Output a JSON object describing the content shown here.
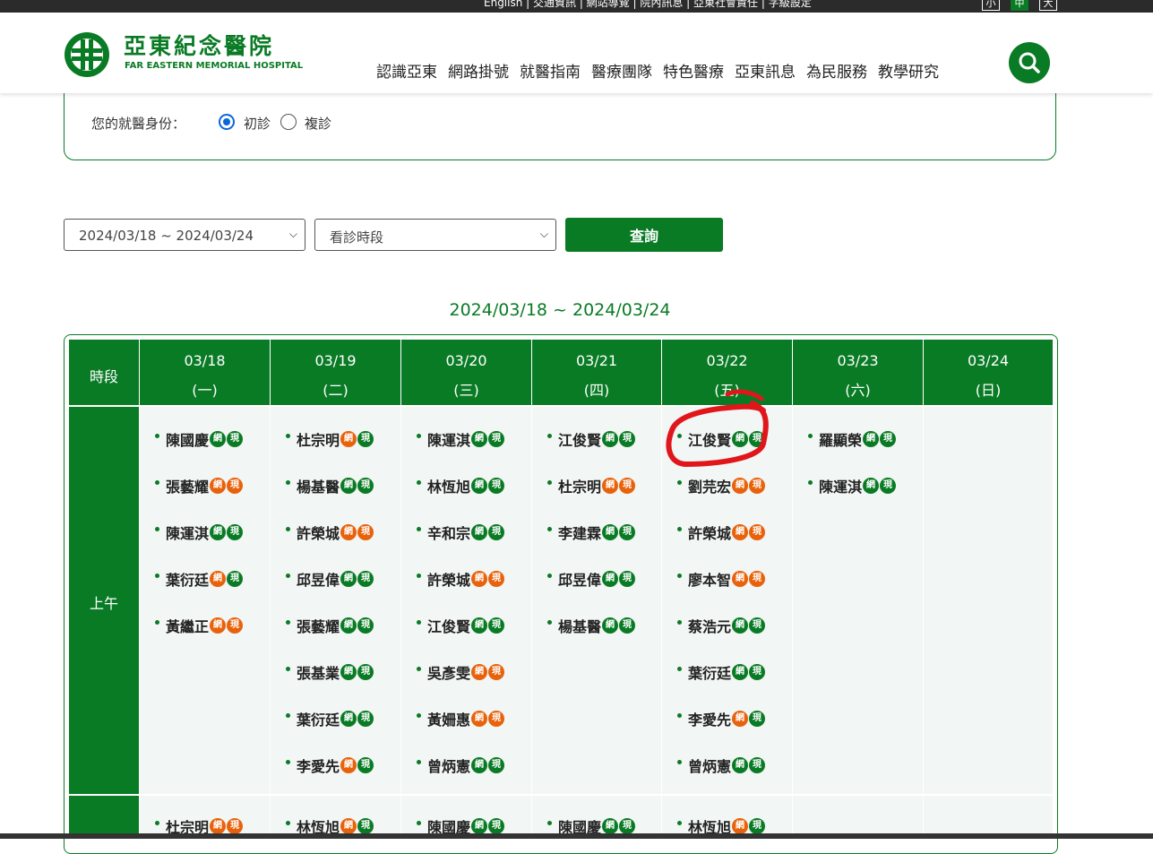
{
  "top_links": "English | 交通資訊 | 網站導覽 | 院內訊息 | 亞東社會責任 | 字級設定",
  "font_sizes": [
    "小",
    "中",
    "大"
  ],
  "header": {
    "name_zh": "亞東紀念醫院",
    "name_en": "FAR EASTERN MEMORIAL HOSPITAL",
    "nav": [
      "認識亞東",
      "網路掛號",
      "就醫指南",
      "醫療團隊",
      "特色醫療",
      "亞東訊息",
      "為民服務",
      "教學研究"
    ]
  },
  "identity": {
    "label": "您的就醫身份：",
    "first_visit": "初診",
    "return_visit": "複診",
    "selected": "first_visit"
  },
  "filters": {
    "week_value": "2024/03/18 ~ 2024/03/24",
    "period_placeholder": "看診時段",
    "query_label": "查詢"
  },
  "schedule_title": "2024/03/18 ~ 2024/03/24",
  "table": {
    "period_header": "時段",
    "days": [
      {
        "date": "03/18",
        "weekday": "(一)"
      },
      {
        "date": "03/19",
        "weekday": "(二)"
      },
      {
        "date": "03/20",
        "weekday": "(三)"
      },
      {
        "date": "03/21",
        "weekday": "(四)"
      },
      {
        "date": "03/22",
        "weekday": "(五)"
      },
      {
        "date": "03/23",
        "weekday": "(六)"
      },
      {
        "date": "03/24",
        "weekday": "(日)"
      }
    ],
    "badge_web": "網",
    "badge_onsite": "現",
    "colors": {
      "green": "#0a7b25",
      "orange": "#e8620c",
      "annotation": "#e0161b"
    },
    "morning_label": "上午",
    "morning": [
      [
        {
          "n": "陳國慶",
          "w": "g",
          "s": "g"
        },
        {
          "n": "張藝耀",
          "w": "o",
          "s": "o"
        },
        {
          "n": "陳運淇",
          "w": "g",
          "s": "g"
        },
        {
          "n": "葉衍廷",
          "w": "o",
          "s": "g"
        },
        {
          "n": "黃繼正",
          "w": "o",
          "s": "o"
        }
      ],
      [
        {
          "n": "杜宗明",
          "w": "o",
          "s": "g"
        },
        {
          "n": "楊基醫",
          "w": "g",
          "s": "g"
        },
        {
          "n": "許榮城",
          "w": "o",
          "s": "o"
        },
        {
          "n": "邱昱偉",
          "w": "g",
          "s": "g"
        },
        {
          "n": "張藝耀",
          "w": "g",
          "s": "g"
        },
        {
          "n": "張基業",
          "w": "g",
          "s": "g"
        },
        {
          "n": "葉衍廷",
          "w": "g",
          "s": "g"
        },
        {
          "n": "李愛先",
          "w": "o",
          "s": "g"
        }
      ],
      [
        {
          "n": "陳運淇",
          "w": "g",
          "s": "g"
        },
        {
          "n": "林恆旭",
          "w": "g",
          "s": "g"
        },
        {
          "n": "辛和宗",
          "w": "g",
          "s": "g"
        },
        {
          "n": "許榮城",
          "w": "o",
          "s": "o"
        },
        {
          "n": "江俊賢",
          "w": "g",
          "s": "g"
        },
        {
          "n": "吳彥雯",
          "w": "o",
          "s": "o"
        },
        {
          "n": "黃姍惠",
          "w": "o",
          "s": "o"
        },
        {
          "n": "曾炳憲",
          "w": "g",
          "s": "g"
        }
      ],
      [
        {
          "n": "江俊賢",
          "w": "g",
          "s": "g"
        },
        {
          "n": "杜宗明",
          "w": "o",
          "s": "o"
        },
        {
          "n": "李建霖",
          "w": "g",
          "s": "g"
        },
        {
          "n": "邱昱偉",
          "w": "g",
          "s": "g"
        },
        {
          "n": "楊基醫",
          "w": "g",
          "s": "g"
        }
      ],
      [
        {
          "n": "江俊賢",
          "w": "g",
          "s": "g"
        },
        {
          "n": "劉芫宏",
          "w": "o",
          "s": "o"
        },
        {
          "n": "許榮城",
          "w": "o",
          "s": "o"
        },
        {
          "n": "廖本智",
          "w": "o",
          "s": "o"
        },
        {
          "n": "蔡浩元",
          "w": "g",
          "s": "g"
        },
        {
          "n": "葉衍廷",
          "w": "g",
          "s": "g"
        },
        {
          "n": "李愛先",
          "w": "o",
          "s": "g"
        },
        {
          "n": "曾炳憲",
          "w": "g",
          "s": "g"
        }
      ],
      [
        {
          "n": "羅顯榮",
          "w": "g",
          "s": "g"
        },
        {
          "n": "陳運淇",
          "w": "g",
          "s": "g"
        }
      ],
      []
    ],
    "next_row": [
      [
        {
          "n": "杜宗明",
          "w": "o",
          "s": "o"
        }
      ],
      [
        {
          "n": "林恆旭",
          "w": "o",
          "s": "g"
        }
      ],
      [
        {
          "n": "陳國慶",
          "w": "g",
          "s": "g"
        }
      ],
      [
        {
          "n": "陳國慶",
          "w": "g",
          "s": "g"
        }
      ],
      [
        {
          "n": "林恆旭",
          "w": "o",
          "s": "g"
        }
      ],
      [],
      []
    ]
  }
}
